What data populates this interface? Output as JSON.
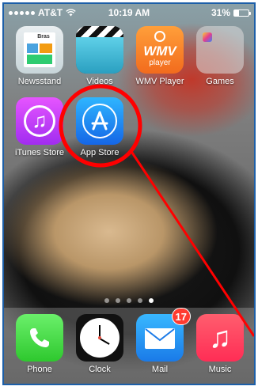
{
  "statusbar": {
    "carrier": "AT&T",
    "time": "10:19 AM",
    "battery_text": "31%",
    "battery_level": 0.31,
    "signal_dots": 5,
    "wifi_icon": "wifi-icon"
  },
  "apps": {
    "row1": [
      {
        "name": "newsstand",
        "label": "Newsstand"
      },
      {
        "name": "videos",
        "label": "Videos"
      },
      {
        "name": "wmv-player",
        "label": "WMV Player",
        "icon_text_top": "WMV",
        "icon_text_bottom": "player"
      },
      {
        "name": "games",
        "label": "Games"
      }
    ],
    "row2": [
      {
        "name": "itunes-store",
        "label": "iTunes Store"
      },
      {
        "name": "app-store",
        "label": "App Store"
      }
    ],
    "newsstand_icon_text": "Bras",
    "dock": [
      {
        "name": "phone",
        "label": "Phone"
      },
      {
        "name": "clock",
        "label": "Clock"
      },
      {
        "name": "mail",
        "label": "Mail",
        "badge": "17"
      },
      {
        "name": "music",
        "label": "Music"
      }
    ]
  },
  "pager": {
    "page_count": 5,
    "active_index": 4
  },
  "annotation": {
    "color": "#ff0000",
    "target": "app-store"
  }
}
